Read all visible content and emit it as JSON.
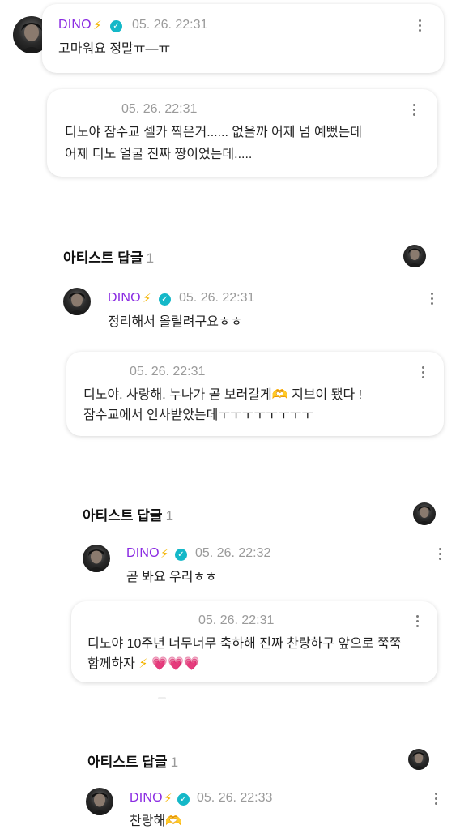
{
  "comment1": {
    "author": "DINO",
    "bolt": "⚡",
    "time": "05. 26. 22:31",
    "text": "고마워요 정말ㅠ—ㅠ"
  },
  "comment2": {
    "time": "05. 26. 22:31",
    "line1": "디노야 잠수교 셀카 찍은거...... 없을까 어제 넘 예뻤는데",
    "line2": "어제 디노 얼굴 진짜 짱이었는데....."
  },
  "section1": {
    "title": "아티스트 답글",
    "count": "1"
  },
  "reply1": {
    "author": "DINO",
    "bolt": "⚡",
    "time": "05. 26. 22:31",
    "text": "정리해서 올릴려구요ㅎㅎ"
  },
  "comment3": {
    "time": "05. 26. 22:31",
    "line1": "디노야. 사랑해. 누나가 곧 보러갈게🫶 지브이 됐다 !",
    "line2": "잠수교에서 인사받았는데ㅜㅜㅜㅜㅜㅜㅜㅜ"
  },
  "section2": {
    "title": "아티스트 답글",
    "count": "1"
  },
  "reply2": {
    "author": "DINO",
    "bolt": "⚡",
    "time": "05. 26. 22:32",
    "text": "곧 봐요 우리ㅎㅎ"
  },
  "comment4": {
    "time": "05. 26. 22:31",
    "line1": "디노야 10주년 너무너무 축하해 진짜 찬랑하구 앞으로 쭉쭉",
    "line2_text": "함께하자",
    "line2_emoji": "⚡",
    "hearts": "💗💗💗"
  },
  "section3": {
    "title": "아티스트 답글",
    "count": "1"
  },
  "reply3": {
    "author": "DINO",
    "bolt": "⚡",
    "time": "05. 26. 22:33",
    "text": "찬랑해🫶"
  },
  "colors": {
    "name": "#8a2be2",
    "verified": "#14b8c8",
    "bolt": "#f4b400",
    "time": "#9a9a9a"
  },
  "icons": {
    "verified": "verified-badge-icon",
    "more": "more-vertical-icon"
  }
}
